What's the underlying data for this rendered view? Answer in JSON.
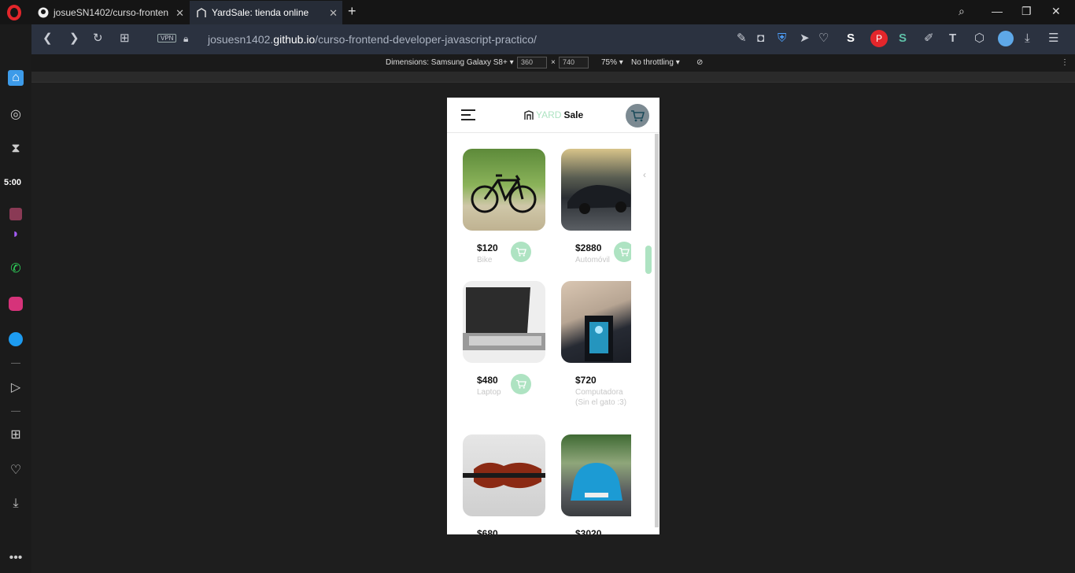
{
  "tabs": [
    {
      "title": "josueSN1402/curso-fronten",
      "active": false
    },
    {
      "title": "YardSale: tienda online",
      "active": true
    }
  ],
  "address_bar": {
    "vpn_label": "VPN",
    "url_prefix": "josuesn1402.",
    "url_domain": "github.io",
    "url_path": "/curso-frontend-developer-javascript-practico/"
  },
  "devtools": {
    "dimensions_label": "Dimensions: Samsung Galaxy S8+ ▾",
    "width": "360",
    "times": "×",
    "height": "740",
    "zoom": "75% ▾",
    "throttling": "No throttling ▾"
  },
  "sidebar": {
    "clock": "5:00",
    "icons": [
      "home-icon",
      "compass-icon",
      "hourglass-icon",
      "app-icon",
      "messenger-icon",
      "whatsapp-icon",
      "instagram-icon",
      "twitter-icon",
      "player-icon",
      "grid-icon",
      "heart-icon",
      "download-icon",
      "more-icon"
    ]
  },
  "app": {
    "brand_yard": "YARD",
    "brand_sale": "Sale",
    "cart_count": "",
    "products": [
      {
        "price": "$120",
        "name": "Bike"
      },
      {
        "price": "$2880",
        "name": "Automóvil"
      },
      {
        "price": "$480",
        "name": "Laptop"
      },
      {
        "price": "$720",
        "name": "Computadora (Sin el gato :3)"
      },
      {
        "price": "$680",
        "name": ""
      },
      {
        "price": "$3020",
        "name": ""
      }
    ]
  },
  "colors": {
    "accent_green": "#aee3c2",
    "tab_active": "#262c37",
    "opera_red": "#e3262b"
  }
}
